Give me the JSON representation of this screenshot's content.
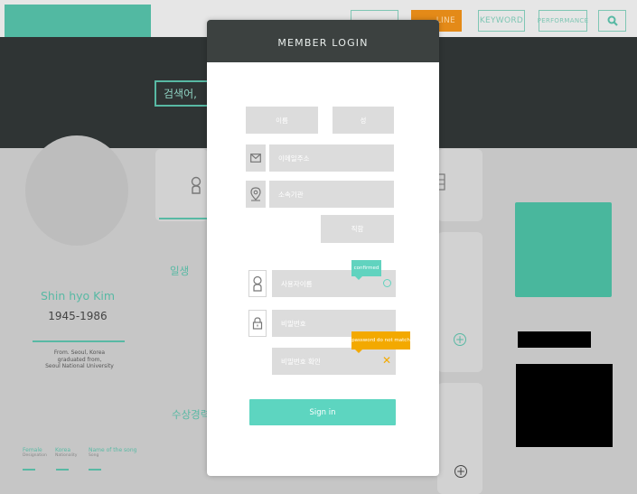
{
  "nav": {
    "online_label": "LINE",
    "keyword_label": "KEYWORD",
    "performance_label": "PERFORMANCE"
  },
  "search": {
    "text": "검색어,"
  },
  "profile": {
    "name": "Shin hyo Kim",
    "years": "1945-1986",
    "from_line1": "From. Seoul, Korea",
    "from_line2": "graduated from,",
    "from_line3": "Seoul National University",
    "meta": [
      {
        "label": "Female",
        "sub": "Designation"
      },
      {
        "label": "Korea",
        "sub": "Nationality"
      },
      {
        "label": "Name of the song",
        "sub": "Song"
      }
    ]
  },
  "sections": {
    "life": "일생",
    "awards": "수상경력"
  },
  "modal": {
    "title": "MEMBER LOGIN",
    "last_name": "이름",
    "first_name": "성",
    "email_placeholder": "이메일주소",
    "org_placeholder": "소속기관",
    "position": "직함",
    "username_placeholder": "사용자이름",
    "password_placeholder": "비밀번호",
    "password_confirm_placeholder": "비밀번호 확인",
    "confirmed_tip": "confirmed",
    "mismatch_tip": "password do not match",
    "sign_in": "Sign in"
  },
  "colors": {
    "teal": "#5dd5c0",
    "dark": "#3c4140",
    "orange": "#f3a900",
    "field": "#dcdcdc"
  }
}
